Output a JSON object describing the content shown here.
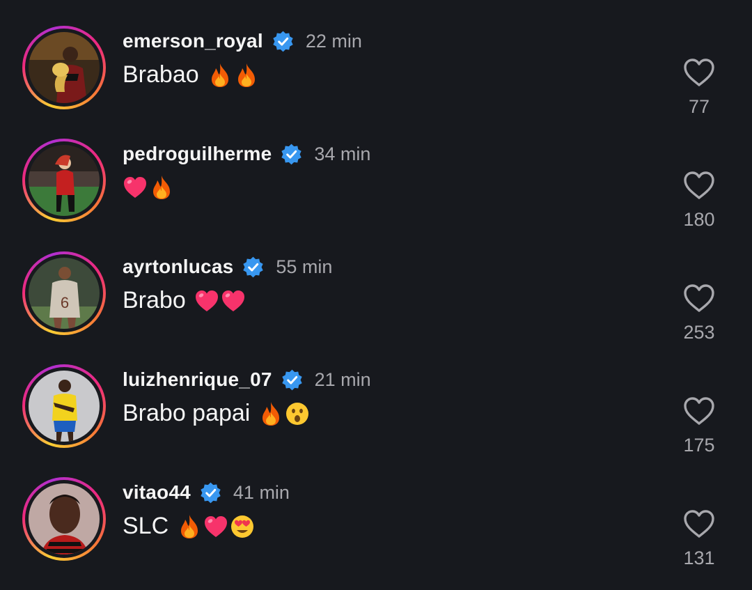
{
  "comments": [
    {
      "username": "emerson_royal",
      "time": "22 min",
      "text": "Brabao",
      "emojis": [
        "fire-icon",
        "fire-icon"
      ],
      "likes": "77",
      "verified": true
    },
    {
      "username": "pedroguilherme",
      "time": "34 min",
      "text": "",
      "emojis": [
        "heart-emoji-icon",
        "fire-icon"
      ],
      "likes": "180",
      "verified": true
    },
    {
      "username": "ayrtonlucas",
      "time": "55 min",
      "text": "Brabo",
      "emojis": [
        "heart-emoji-icon",
        "heart-emoji-icon"
      ],
      "likes": "253",
      "verified": true
    },
    {
      "username": "luizhenrique_07",
      "time": "21 min",
      "text": "Brabo papai",
      "emojis": [
        "fire-icon",
        "surprised-face-icon"
      ],
      "likes": "175",
      "verified": true
    },
    {
      "username": "vitao44",
      "time": "41 min",
      "text": "SLC",
      "emojis": [
        "fire-icon",
        "heart-emoji-icon",
        "heart-eyes-face-icon"
      ],
      "likes": "131",
      "verified": true
    }
  ],
  "colors": {
    "background": "#17191e",
    "text": "#f5f5f5",
    "muted": "#a8a8ad",
    "verified_badge": "#3897f0",
    "story_ring": [
      "#f9ce34",
      "#ee2a7b",
      "#b12fd0"
    ]
  }
}
